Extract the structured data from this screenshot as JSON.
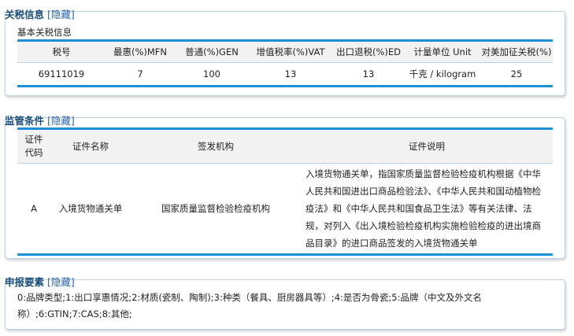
{
  "tariff": {
    "title": "关税信息",
    "toggle": "[隐藏]",
    "subtitle": "基本关税信息",
    "headers": [
      "税号",
      "最惠(%)MFN",
      "普通(%)GEN",
      "增值税率(%)VAT",
      "出口退税(%)ED",
      "计量单位 Unit",
      "对美加征关税(%)"
    ],
    "row": [
      "69111019",
      "7",
      "100",
      "13",
      "13",
      "千克 / kilogram",
      "25"
    ]
  },
  "regulation": {
    "title": "监管条件",
    "toggle": "[隐藏]",
    "headers": [
      "证件\n代码",
      "证件名称",
      "签发机构",
      "证件说明"
    ],
    "row": {
      "code": "A",
      "name": "入境货物通关单",
      "issuer": "国家质量监督检验检疫机构",
      "description": "入境货物通关单，指国家质量监督检验检疫机构根据《中华人民共和国进出口商品检验法》、《中华人民共和国动植物检疫法》和《中华人民共和国食品卫生法》等有关法律、法规，对列入《出入境检验检疫机构实施检验检疫的进出境商品目录》的进口商品签发的入境货物通关单"
    }
  },
  "declaration": {
    "title": "申报要素",
    "toggle": "[隐藏]",
    "text": "0:品牌类型;1:出口享惠情况;2:材质(瓷制、陶制);3:种类（餐具、厨房器具等）;4:是否为骨瓷;5:品牌（中文及外文名称）;6:GTIN;7:CAS;8:其他;"
  }
}
